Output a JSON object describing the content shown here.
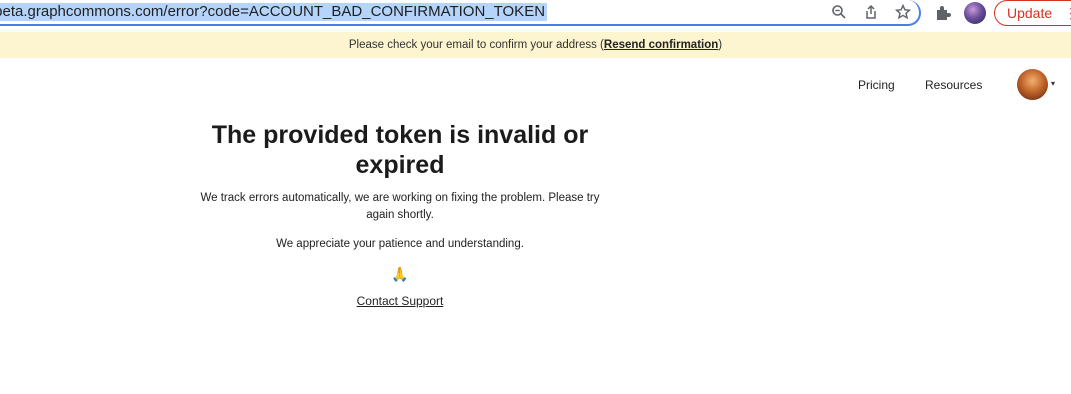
{
  "browser": {
    "url": "/beta.graphcommons.com/error?code=ACCOUNT_BAD_CONFIRMATION_TOKEN",
    "icons": [
      "zoom-icon",
      "share-icon",
      "bookmark-star-icon",
      "extensions-icon"
    ],
    "update_label": "Update",
    "menu_glyph": "⋮"
  },
  "banner": {
    "text_before": "Please check your email to confirm your address (",
    "link_label": "Resend confirmation",
    "text_after": ")"
  },
  "nav": {
    "pricing": "Pricing",
    "resources": "Resources",
    "caret": "▾"
  },
  "error": {
    "title": "The provided token is invalid or expired",
    "message": "We track errors automatically, we are working on fixing the problem. Please try again shortly.",
    "appreciation": "We appreciate your patience and understanding.",
    "emoji": "🙏",
    "support_label": "Contact Support"
  },
  "colors": {
    "banner_bg": "#fdf5cf",
    "focus_ring": "#4a7ee8",
    "url_highlight": "#b4d4fc",
    "update_red": "#d93025"
  }
}
